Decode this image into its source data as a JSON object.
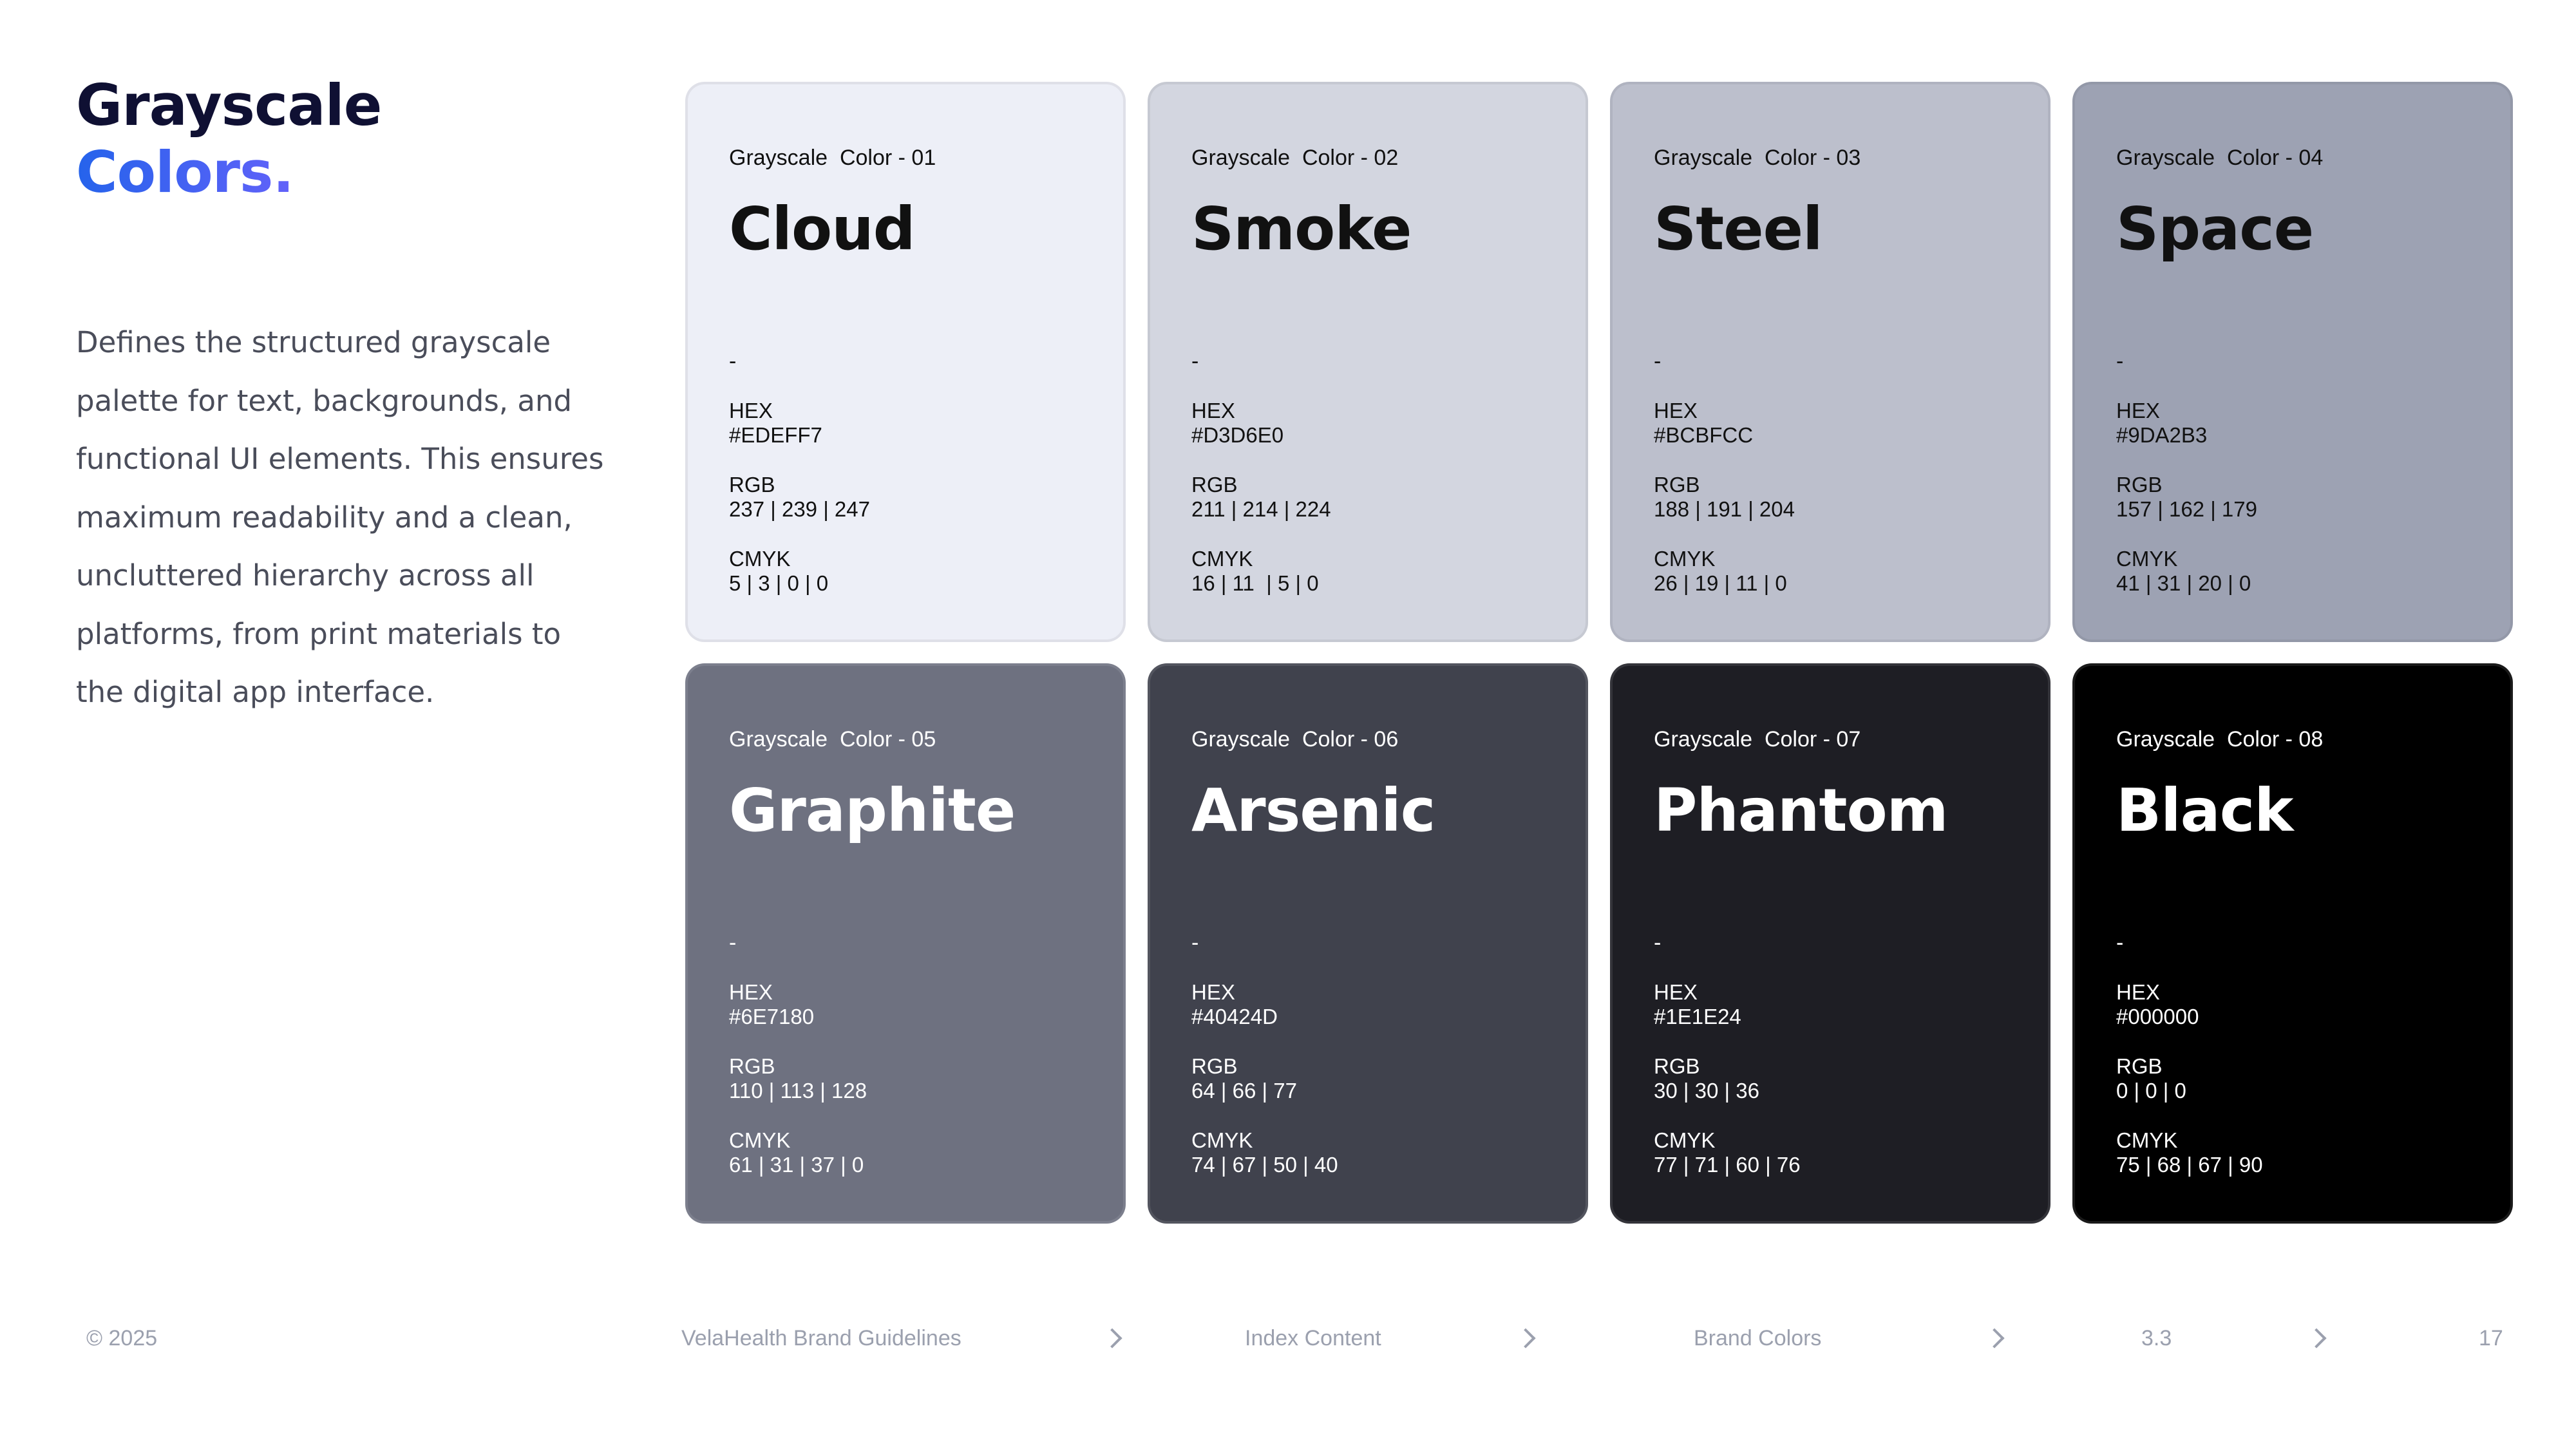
{
  "page": {
    "title_line1": "Grayscale",
    "title_line2": "Colors.",
    "description": "Defines the structured grayscale palette for text, backgrounds, and functional UI elements. This ensures maximum readability and a clean, uncluttered hierarchy across all platforms, from print materials to the digital app interface."
  },
  "spec_labels": {
    "hex": "HEX",
    "rgb": "RGB",
    "cmyk": "CMYK",
    "dash": "-"
  },
  "cards": [
    {
      "label": "Grayscale  Color - 01",
      "name": "Cloud",
      "hex": "#EDEFF7",
      "rgb": "237 | 239 | 247",
      "cmyk": "5 | 3 | 0 | 0",
      "bg": "#EDEFF7",
      "text": "#111111"
    },
    {
      "label": "Grayscale  Color - 02",
      "name": "Smoke",
      "hex": "#D3D6E0",
      "rgb": "211 | 214 | 224",
      "cmyk": "16 | 11  | 5 | 0",
      "bg": "#D3D6E0",
      "text": "#111111"
    },
    {
      "label": "Grayscale  Color - 03",
      "name": "Steel",
      "hex": "#BCBFCC",
      "rgb": "188 | 191 | 204",
      "cmyk": "26 | 19 | 11 | 0",
      "bg": "#BCBFCC",
      "text": "#111111"
    },
    {
      "label": "Grayscale  Color - 04",
      "name": "Space",
      "hex": "#9DA2B3",
      "rgb": "157 | 162 | 179",
      "cmyk": "41 | 31 | 20 | 0",
      "bg": "#9DA2B3",
      "text": "#111111"
    },
    {
      "label": "Grayscale  Color - 05",
      "name": "Graphite",
      "hex": "#6E7180",
      "rgb": "110 | 113 | 128",
      "cmyk": "61 | 31 | 37 | 0",
      "bg": "#6E7180",
      "text": "#ffffff"
    },
    {
      "label": "Grayscale  Color - 06",
      "name": "Arsenic",
      "hex": "#40424D",
      "rgb": "64 | 66 | 77",
      "cmyk": "74 | 67 | 50 | 40",
      "bg": "#40424D",
      "text": "#ffffff"
    },
    {
      "label": "Grayscale  Color - 07",
      "name": "Phantom",
      "hex": "#1E1E24",
      "rgb": "30 | 30 | 36",
      "cmyk": "77 | 71 | 60 | 76",
      "bg": "#1E1E24",
      "text": "#ffffff"
    },
    {
      "label": "Grayscale  Color - 08",
      "name": "Black",
      "hex": "#000000",
      "rgb": "0 | 0 | 0",
      "cmyk": "75 | 68 | 67 | 90",
      "bg": "#000000",
      "text": "#ffffff"
    }
  ],
  "footer": {
    "copyright": "© 2025",
    "doc_title": "VelaHealth Brand Guidelines",
    "section": "Index Content",
    "subsection": "Brand Colors",
    "section_number": "3.3",
    "page_number": "17"
  }
}
